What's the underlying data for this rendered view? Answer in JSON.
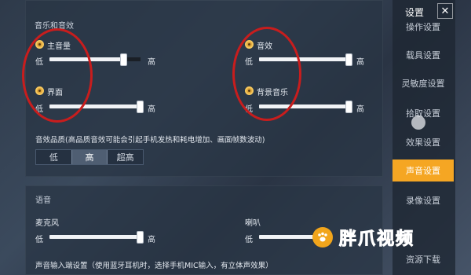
{
  "audio": {
    "section_title": "音乐和音效",
    "master_volume": {
      "label": "主音量",
      "low": "低",
      "high": "高",
      "level": 0.84
    },
    "sfx": {
      "label": "音效",
      "low": "低",
      "high": "高",
      "level": 0.98
    },
    "interface": {
      "label": "界面",
      "low": "低",
      "high": "高",
      "level": 0.98
    },
    "bgm": {
      "label": "背景音乐",
      "low": "低",
      "high": "高",
      "level": 0.98
    },
    "quality_label": "音效品质(高品质音效可能会引起手机发热和耗电增加、画面帧数波动)",
    "quality_options": [
      "低",
      "高",
      "超高"
    ],
    "quality_selected": "高"
  },
  "voice": {
    "section_title": "语音",
    "mic": {
      "label": "麦克风",
      "low": "低",
      "high": "高",
      "level": 0.98
    },
    "speaker": {
      "label": "喇叭",
      "low": "低",
      "level": 0.9
    },
    "input_label": "声音输入端设置（使用蓝牙耳机时，选择手机MIC输入，有立体声效果）"
  },
  "sidebar": {
    "title": "设置",
    "close": "✕",
    "items": [
      "操作设置",
      "载具设置",
      "灵敏度设置",
      "拾取设置",
      "效果设置",
      "声音设置",
      "录像设置",
      "资源下载"
    ],
    "active": "声音设置"
  },
  "watermark": {
    "text": "胖爪视频"
  },
  "colors": {
    "accent": "#f5a623",
    "annotation": "#c81d1d",
    "watermark": "#f2a51b"
  }
}
